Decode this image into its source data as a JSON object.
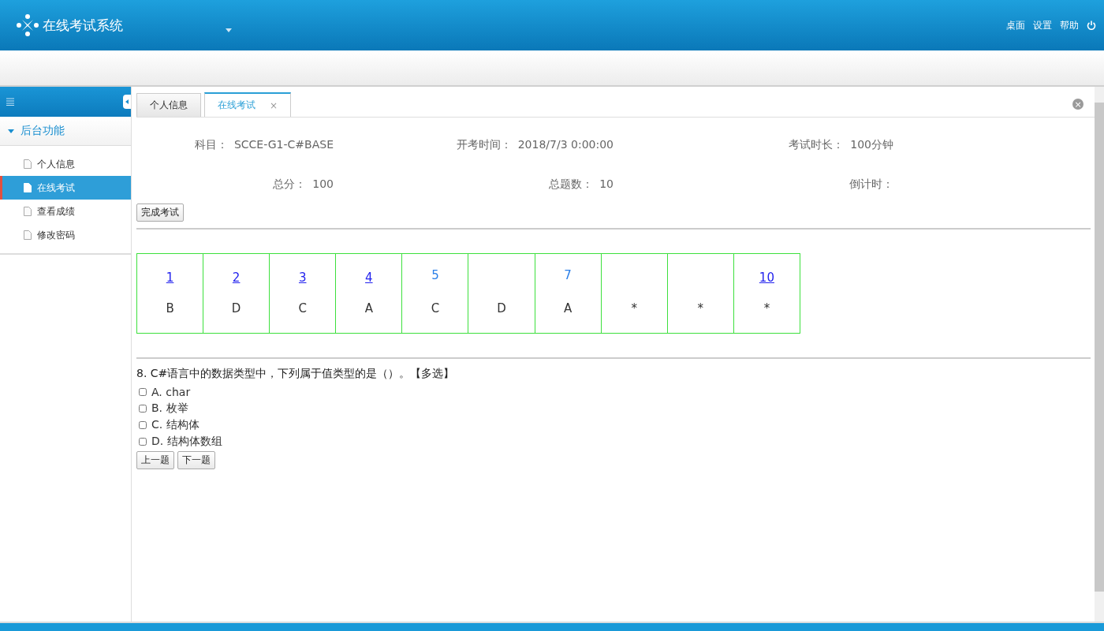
{
  "header": {
    "title": "在线考试系统",
    "links": [
      "桌面",
      "设置",
      "帮助"
    ]
  },
  "sidebar": {
    "group": {
      "label": "后台功能",
      "expanded": true
    },
    "items": [
      {
        "label": "个人信息",
        "selected": false
      },
      {
        "label": "在线考试",
        "selected": true
      },
      {
        "label": "查看成绩",
        "selected": false
      },
      {
        "label": "修改密码",
        "selected": false
      }
    ]
  },
  "tabs": [
    {
      "label": "个人信息",
      "selected": false,
      "closable": false
    },
    {
      "label": "在线考试",
      "selected": true,
      "closable": true
    }
  ],
  "close_glyph": "×",
  "info": [
    [
      {
        "label": "科目：",
        "value": "SCCE-G1-C#BASE"
      },
      {
        "label": "开考时间：",
        "value": "2018/7/3 0:00:00"
      },
      {
        "label": "考试时长：",
        "value": "100分钟"
      }
    ],
    [
      {
        "label": "总分：",
        "value": "100"
      },
      {
        "label": "总题数：",
        "value": "10"
      },
      {
        "label": "倒计时："
      }
    ]
  ],
  "finish_button": "完成考试",
  "answer_grid": [
    {
      "number": "1",
      "underlined": true,
      "answer": "B"
    },
    {
      "number": "2",
      "underlined": true,
      "answer": "D"
    },
    {
      "number": "3",
      "underlined": true,
      "answer": "C"
    },
    {
      "number": "4",
      "underlined": true,
      "answer": "A"
    },
    {
      "number": "5",
      "underlined": false,
      "answer": "C"
    },
    {
      "answer": "D"
    },
    {
      "number": "7",
      "underlined": false,
      "answer": "A"
    },
    {
      "answer": "*"
    },
    {
      "answer": "*"
    },
    {
      "number": "10",
      "underlined": true,
      "answer": "*"
    }
  ],
  "question": {
    "text": "8. C#语言中的数据类型中，下列属于值类型的是（）。【多选】",
    "options": [
      {
        "label": "A. char",
        "checked": false
      },
      {
        "label": "B. 枚举",
        "checked": false
      },
      {
        "label": "C. 结构体",
        "checked": false
      },
      {
        "label": "D. 结构体数组",
        "checked": false
      }
    ]
  },
  "nav_buttons": [
    "上一题",
    "下一题"
  ]
}
